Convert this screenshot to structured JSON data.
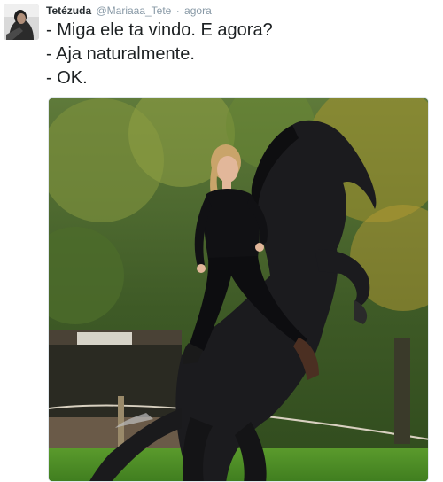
{
  "tweet": {
    "avatar_icon": "user-avatar-photo",
    "display_name": "Tetézuda",
    "handle": "@Mariaaa_Tete",
    "separator": "·",
    "time": "agora",
    "text_lines": [
      "- Miga ele ta vindo. E agora?",
      "- Aja naturalmente.",
      "- OK."
    ],
    "media": {
      "icon": "photo-woman-on-rearing-horse",
      "sign_text": ""
    }
  },
  "colors": {
    "name": "#292f33",
    "meta": "#8899a6",
    "text": "#1c2022"
  }
}
